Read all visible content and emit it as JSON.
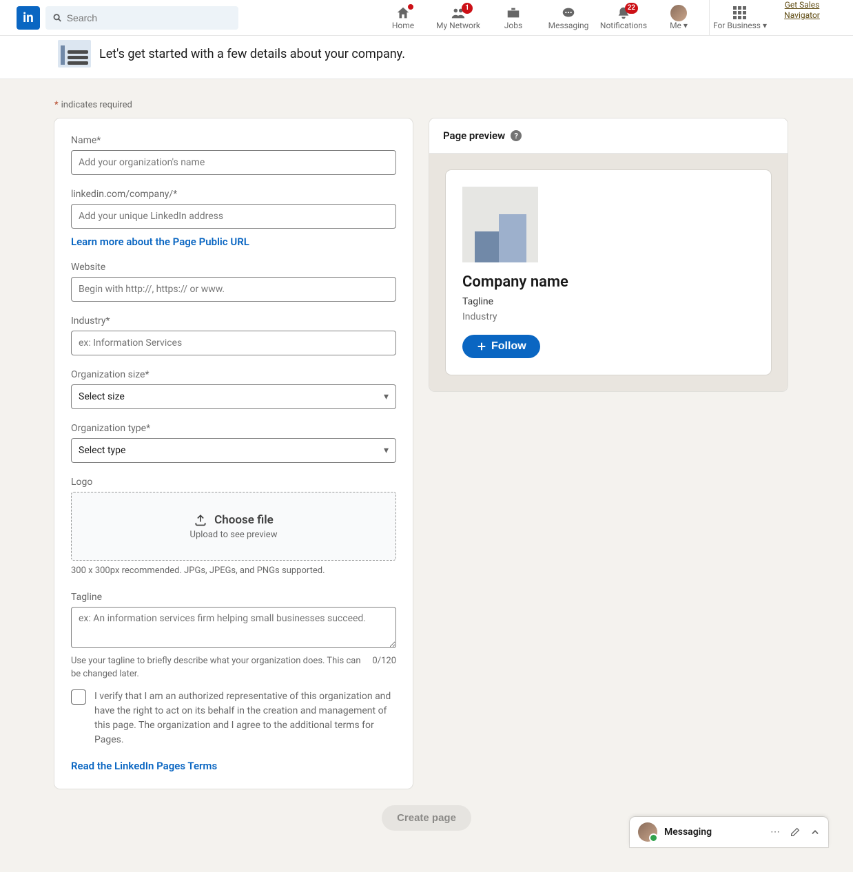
{
  "nav": {
    "search_placeholder": "Search",
    "home": "Home",
    "network": "My Network",
    "network_badge": "1",
    "jobs": "Jobs",
    "messaging": "Messaging",
    "notifications": "Notifications",
    "notifications_badge": "22",
    "me": "Me ▾",
    "for_business": "For Business ▾",
    "sales_link": "Get Sales Navigator"
  },
  "subheader": {
    "heading": "Let's get started with a few details about your company."
  },
  "required_text": "indicates required",
  "form": {
    "name_label": "Name*",
    "name_placeholder": "Add your organization's name",
    "url_label": "linkedin.com/company/*",
    "url_placeholder": "Add your unique LinkedIn address",
    "url_help_link": "Learn more about the Page Public URL",
    "website_label": "Website",
    "website_placeholder": "Begin with http://, https:// or www.",
    "industry_label": "Industry*",
    "industry_placeholder": "ex: Information Services",
    "size_label": "Organization size*",
    "size_value": "Select size",
    "type_label": "Organization type*",
    "type_value": "Select type",
    "logo_label": "Logo",
    "logo_choose": "Choose file",
    "logo_hint_inline": "Upload to see preview",
    "logo_hint_below": "300 x 300px recommended. JPGs, JPEGs, and PNGs supported.",
    "tagline_label": "Tagline",
    "tagline_placeholder": "ex: An information services firm helping small businesses succeed.",
    "tagline_hint": "Use your tagline to briefly describe what your organization does. This can be changed later.",
    "tagline_counter": "0/120",
    "verify_text": "I verify that I am an authorized representative of this organization and have the right to act on its behalf in the creation and management of this page. The organization and I agree to the additional terms for Pages.",
    "terms_link": "Read the LinkedIn Pages Terms"
  },
  "preview": {
    "title": "Page preview",
    "company_name": "Company name",
    "tagline": "Tagline",
    "industry": "Industry",
    "follow": "Follow"
  },
  "footer": {
    "create": "Create page"
  },
  "messaging": {
    "label": "Messaging"
  }
}
